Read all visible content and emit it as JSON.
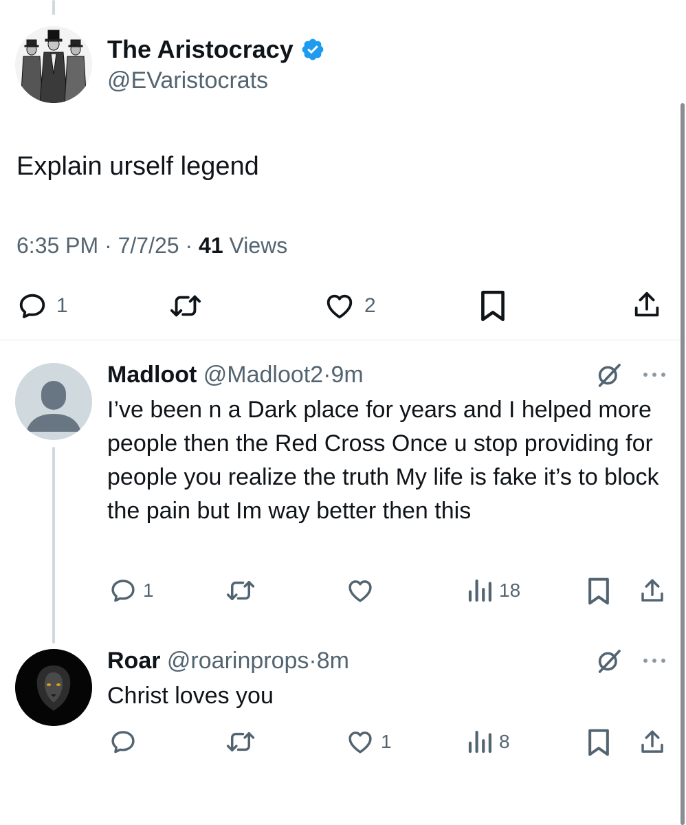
{
  "main_tweet": {
    "display_name": "The Aristocracy",
    "handle": "@EVaristocrats",
    "text": "Explain urself legend",
    "time": "6:35 PM",
    "date": "7/7/25",
    "views_count": "41",
    "views_label": "Views",
    "reply_count": "1",
    "like_count": "2",
    "verified_color": "#1d9bf0"
  },
  "replies": [
    {
      "name": "Madloot",
      "handle": "@Madloot2",
      "time": "9m",
      "text": "I’ve been n a Dark place for years and I helped more people then the Red Cross Once u stop providing for people you realize the truth My life is fake it’s to block the pain but Im way better then this",
      "reply_count": "1",
      "like_count": "",
      "view_count": "18"
    },
    {
      "name": "Roar",
      "handle": "@roarinprops",
      "time": "8m",
      "text": "Christ loves you",
      "reply_count": "",
      "like_count": "1",
      "view_count": "8"
    }
  ],
  "separator": "·",
  "colors": {
    "text": "#0f1419",
    "secondary": "#536471",
    "line": "#cfd9de",
    "accent": "#1d9bf0"
  }
}
